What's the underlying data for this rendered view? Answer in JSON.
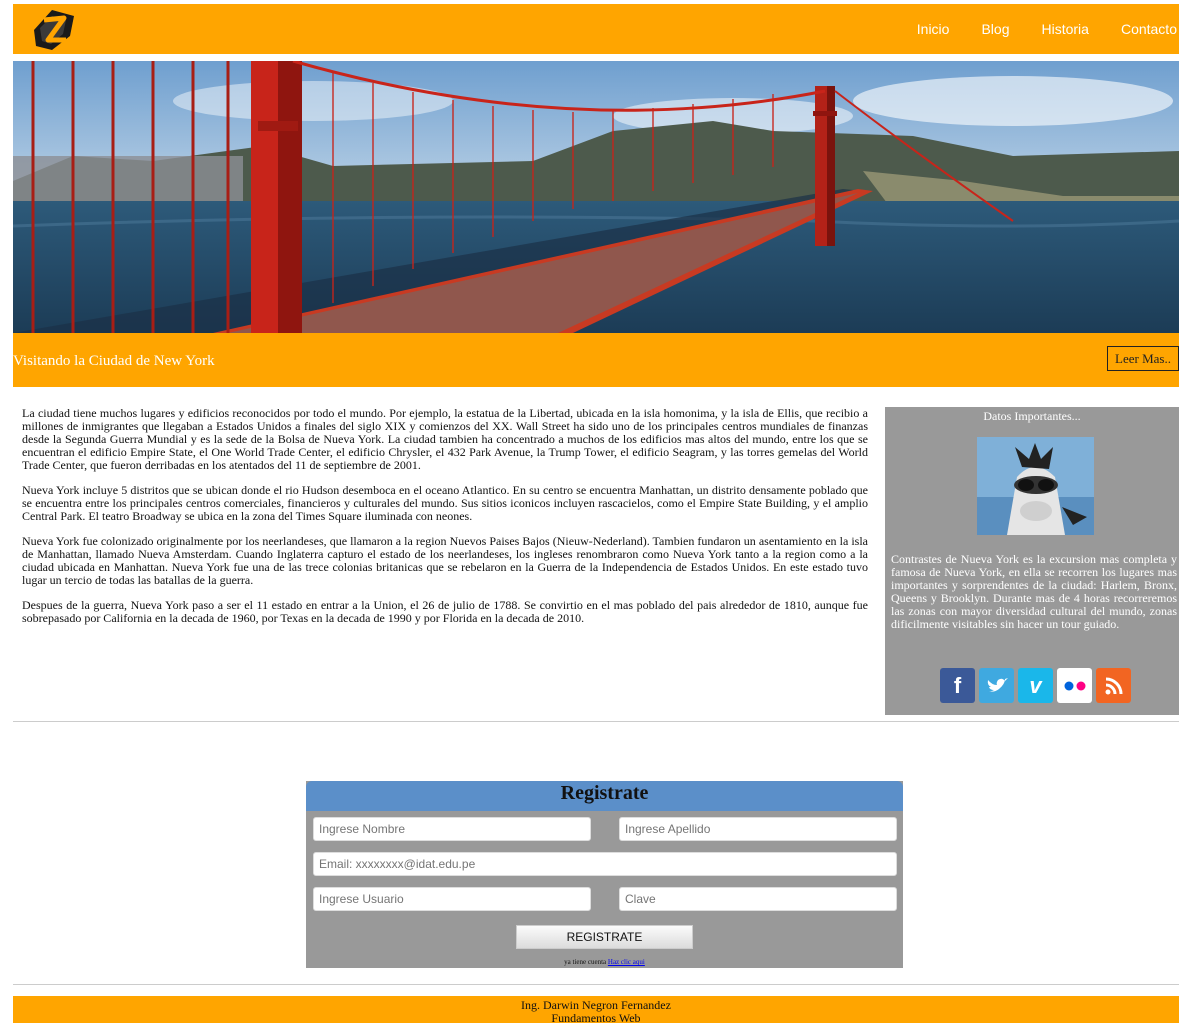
{
  "header": {
    "nav": [
      "Inicio",
      "Blog",
      "Historia",
      "Contacto"
    ],
    "colors": {
      "bar": "#FFA500",
      "nav_text": "#ffffff"
    }
  },
  "hero": {
    "caption": "Visitando la Ciudad de New York",
    "button": "Leer Mas.."
  },
  "article": {
    "paragraphs": [
      "La ciudad tiene muchos lugares y edificios reconocidos por todo el mundo. Por ejemplo, la estatua de la Libertad, ubicada en la isla homonima, y la isla de Ellis, que recibio a millones de inmigrantes que llegaban a Estados Unidos a finales del siglo XIX y comienzos del XX. Wall Street ha sido uno de los principales centros mundiales de finanzas desde la Segunda Guerra Mundial y es la sede de la Bolsa de Nueva York. La ciudad tambien ha concentrado a muchos de los edificios mas altos del mundo, entre los que se encuentran el edificio Empire State, el One World Trade Center, el edificio Chrysler, el 432 Park Avenue, la Trump Tower, el edificio Seagram, y las torres gemelas del World Trade Center, que fueron derribadas en los atentados del 11 de septiembre de 2001.",
      "Nueva York incluye 5 distritos que se ubican donde el rio Hudson desemboca en el oceano Atlantico. En su centro se encuentra Manhattan, un distrito densamente poblado que se encuentra entre los principales centros comerciales, financieros y culturales del mundo. Sus sitios iconicos incluyen rascacielos, como el Empire State Building, y el amplio Central Park. El teatro Broadway se ubica en la zona del Times Square iluminada con neones.",
      "Nueva York fue colonizado originalmente por los neerlandeses, que llamaron a la region Nuevos Paises Bajos (Nieuw-Nederland). Tambien fundaron un asentamiento en la isla de Manhattan, llamado Nueva Amsterdam. Cuando Inglaterra capturo el estado de los neerlandeses, los ingleses renombraron como Nueva York tanto a la region como a la ciudad ubicada en Manhattan. Nueva York fue una de las trece colonias britanicas que se rebelaron en la Guerra de la Independencia de Estados Unidos. En este estado tuvo lugar un tercio de todas las batallas de la guerra.",
      "Despues de la guerra, Nueva York paso a ser el 11 estado en entrar a la Union, el 26 de julio de 1788. Se convirtio en el mas poblado del pais alrededor de 1810, aunque fue sobrepasado por California en la decada de 1960, por Texas en la decada de 1990 y por Florida en la decada de 2010."
    ]
  },
  "sidebar": {
    "title": "Datos Importantes...",
    "text": "Contrastes de Nueva York es la excursion mas completa y famosa de Nueva York, en ella se recorren los lugares mas importantes y sorprendentes de la ciudad: Harlem, Bronx, Queens y Brooklyn. Durante mas de 4 horas recorreremos las zonas con mayor diversidad cultural del mundo, zonas dificilmente visitables sin hacer un tour guiado.",
    "social_icons": [
      "facebook-icon",
      "twitter-icon",
      "vimeo-icon",
      "flickr-icon",
      "rss-icon"
    ]
  },
  "register": {
    "title": "Registrate",
    "nombre_placeholder": "Ingrese Nombre",
    "apellido_placeholder": "Ingrese Apellido",
    "email_placeholder": "Email: xxxxxxxx@idat.edu.pe",
    "usuario_placeholder": "Ingrese Usuario",
    "clave_placeholder": "Clave",
    "button": "REGISTRATE",
    "note": "ya tiene cuenta",
    "link": "Haz clic aqui"
  },
  "footer": {
    "line1": "Ing. Darwin Negron Fernandez",
    "line2": "Fundamentos Web"
  }
}
